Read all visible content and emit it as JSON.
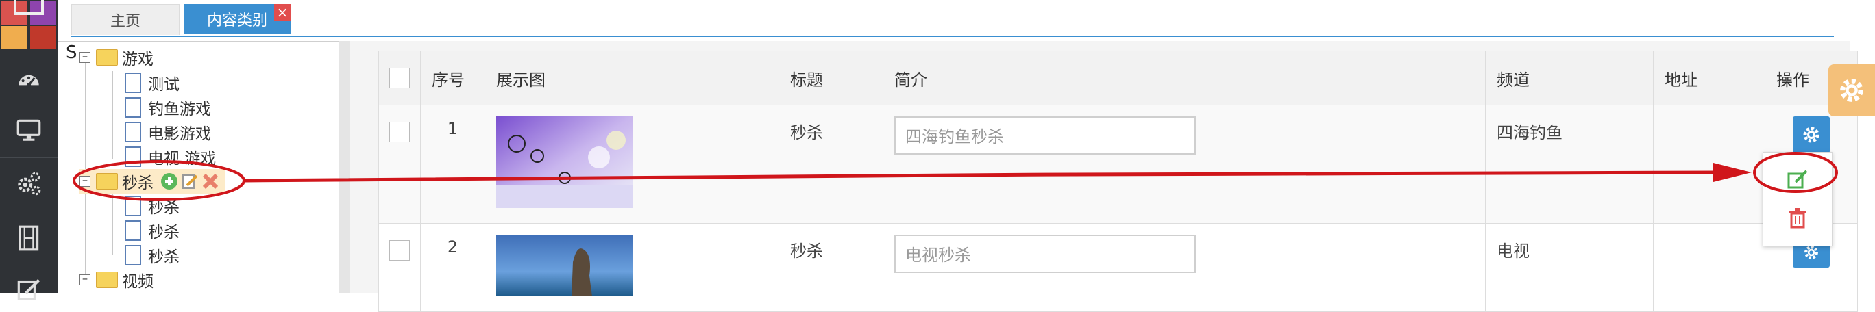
{
  "tabs": {
    "home_label": "主页",
    "active_label": "内容类别",
    "close_glyph": "×"
  },
  "tree": {
    "root_marker": "S",
    "toggle_collapse": "−",
    "folders": [
      {
        "label": "游戏",
        "children": [
          "测试",
          "钓鱼游戏",
          "电影游戏",
          "电视 游戏"
        ]
      },
      {
        "label": "秒杀",
        "children": [
          "秒杀",
          "秒杀",
          "秒杀"
        ]
      },
      {
        "label": "视频",
        "children": []
      }
    ]
  },
  "table": {
    "headers": [
      "序号",
      "展示图",
      "标题",
      "简介",
      "频道",
      "地址",
      "操作"
    ],
    "rows": [
      {
        "index": "1",
        "title": "秒杀",
        "intro_placeholder": "四海钓鱼秒杀",
        "channel": "四海钓鱼",
        "address": ""
      },
      {
        "index": "2",
        "title": "秒杀",
        "intro_placeholder": "电视秒杀",
        "channel": "电视",
        "address": ""
      }
    ]
  },
  "colors": {
    "accent": "#3a8fd1",
    "sidebar": "#2f3236",
    "annotation_red": "#d0161b",
    "edit_green": "#4caf50",
    "delete_red": "#e14d4d"
  },
  "icons": {
    "sidebar": [
      "dashboard-icon",
      "monitor-icon",
      "cogs-icon",
      "film-icon",
      "edit-icon"
    ],
    "row_action": "gear-icon",
    "dropdown": [
      "edit-icon",
      "trash-icon"
    ],
    "tree_node_actions": [
      "add-icon",
      "edit-icon",
      "delete-icon"
    ]
  }
}
